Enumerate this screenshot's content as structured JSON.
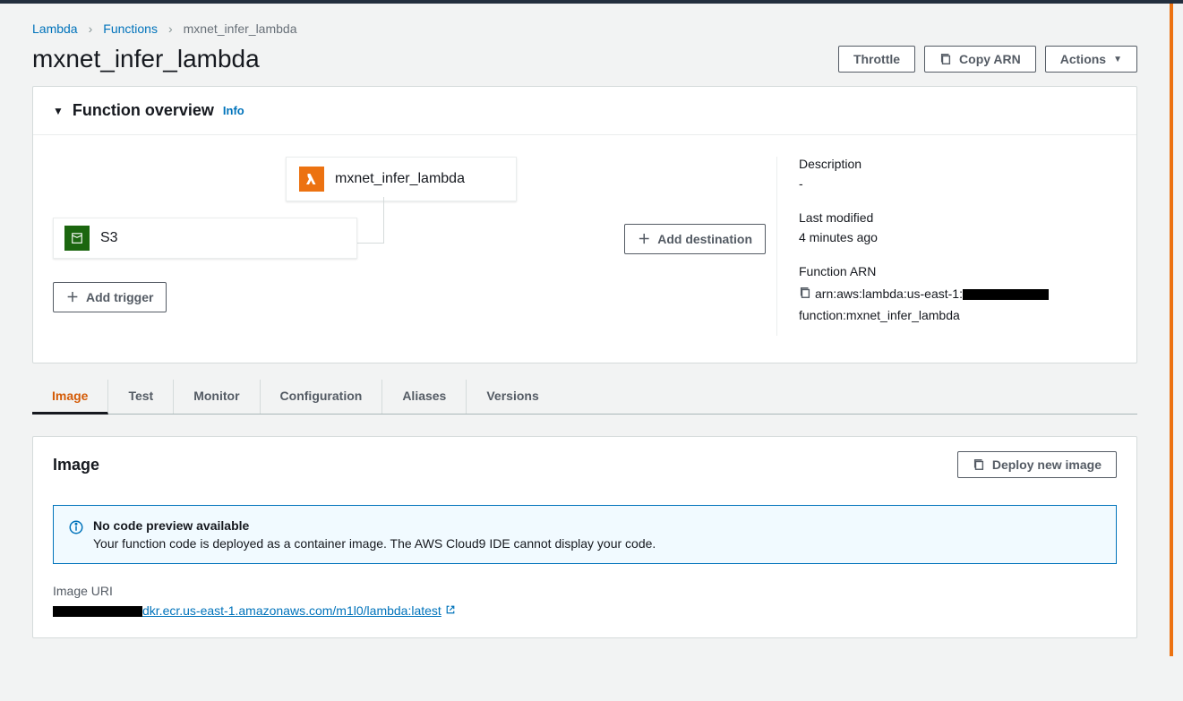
{
  "breadcrumb": {
    "items": [
      "Lambda",
      "Functions"
    ],
    "current": "mxnet_infer_lambda"
  },
  "header": {
    "title": "mxnet_infer_lambda",
    "buttons": {
      "throttle": "Throttle",
      "copy_arn": "Copy ARN",
      "actions": "Actions"
    }
  },
  "overview": {
    "title": "Function overview",
    "info": "Info",
    "function_name": "mxnet_infer_lambda",
    "trigger": {
      "type": "S3",
      "label": "S3"
    },
    "add_trigger": "Add trigger",
    "add_destination": "Add destination",
    "meta": {
      "description_label": "Description",
      "description_value": "-",
      "last_modified_label": "Last modified",
      "last_modified_value": "4 minutes ago",
      "arn_label": "Function ARN",
      "arn_prefix": "arn:aws:lambda:us-east-1:",
      "arn_suffix": "function:mxnet_infer_lambda"
    }
  },
  "tabs": {
    "items": [
      "Image",
      "Test",
      "Monitor",
      "Configuration",
      "Aliases",
      "Versions"
    ],
    "active": 0
  },
  "image_panel": {
    "title": "Image",
    "deploy_button": "Deploy new image",
    "notice_title": "No code preview available",
    "notice_text": "Your function code is deployed as a container image. The AWS Cloud9 IDE cannot display your code.",
    "uri_label": "Image URI",
    "uri_link_text": "dkr.ecr.us-east-1.amazonaws.com/m1l0/lambda:latest"
  }
}
